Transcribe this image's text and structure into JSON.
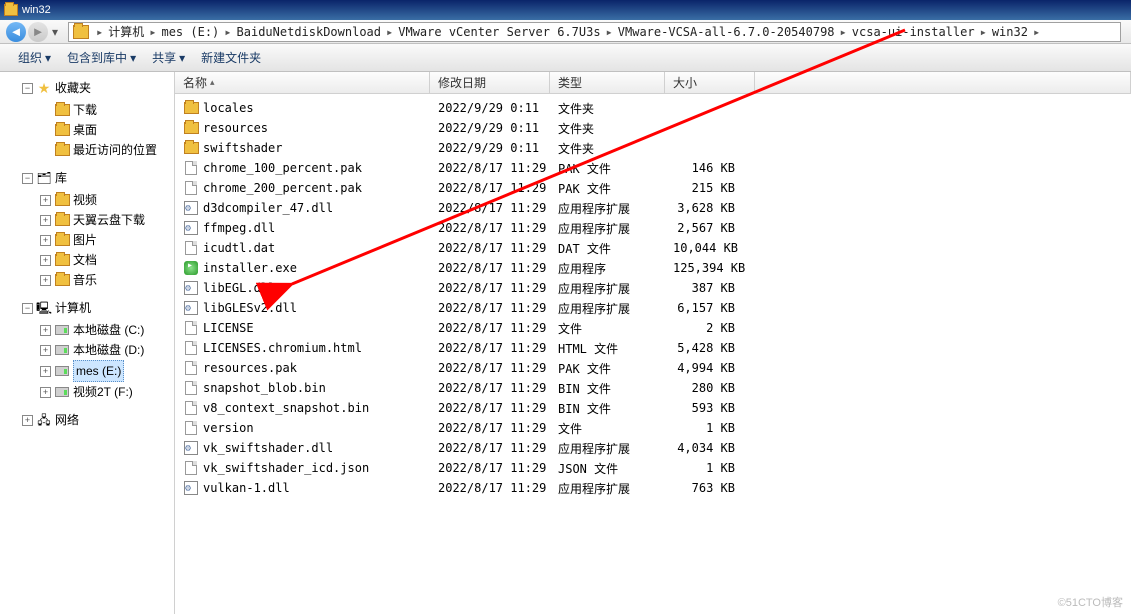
{
  "window": {
    "title": "win32"
  },
  "breadcrumbs": [
    "计算机",
    "mes (E:)",
    "BaiduNetdiskDownload",
    "VMware vCenter Server 6.7U3s",
    "VMware-VCSA-all-6.7.0-20540798",
    "vcsa-ui-installer",
    "win32"
  ],
  "toolbar": {
    "organize": "组织",
    "include": "包含到库中",
    "share": "共享",
    "newfolder": "新建文件夹"
  },
  "columns": {
    "name": "名称",
    "date": "修改日期",
    "type": "类型",
    "size": "大小"
  },
  "sidebar": {
    "favorites": {
      "label": "收藏夹",
      "items": [
        "下载",
        "桌面",
        "最近访问的位置"
      ]
    },
    "libraries": {
      "label": "库",
      "items": [
        "视频",
        "天翼云盘下载",
        "图片",
        "文档",
        "音乐"
      ]
    },
    "computer": {
      "label": "计算机",
      "items": [
        "本地磁盘 (C:)",
        "本地磁盘 (D:)",
        "mes (E:)",
        "视频2T (F:)"
      ]
    },
    "network": {
      "label": "网络"
    }
  },
  "files": [
    {
      "name": "locales",
      "date": "2022/9/29 0:11",
      "type": "文件夹",
      "size": "",
      "icon": "folder"
    },
    {
      "name": "resources",
      "date": "2022/9/29 0:11",
      "type": "文件夹",
      "size": "",
      "icon": "folder"
    },
    {
      "name": "swiftshader",
      "date": "2022/9/29 0:11",
      "type": "文件夹",
      "size": "",
      "icon": "folder"
    },
    {
      "name": "chrome_100_percent.pak",
      "date": "2022/8/17 11:29",
      "type": "PAK 文件",
      "size": "146 KB",
      "icon": "file"
    },
    {
      "name": "chrome_200_percent.pak",
      "date": "2022/8/17 11:29",
      "type": "PAK 文件",
      "size": "215 KB",
      "icon": "file"
    },
    {
      "name": "d3dcompiler_47.dll",
      "date": "2022/8/17 11:29",
      "type": "应用程序扩展",
      "size": "3,628 KB",
      "icon": "dll"
    },
    {
      "name": "ffmpeg.dll",
      "date": "2022/8/17 11:29",
      "type": "应用程序扩展",
      "size": "2,567 KB",
      "icon": "dll"
    },
    {
      "name": "icudtl.dat",
      "date": "2022/8/17 11:29",
      "type": "DAT 文件",
      "size": "10,044 KB",
      "icon": "file"
    },
    {
      "name": "installer.exe",
      "date": "2022/8/17 11:29",
      "type": "应用程序",
      "size": "125,394 KB",
      "icon": "exe"
    },
    {
      "name": "libEGL.dll",
      "date": "2022/8/17 11:29",
      "type": "应用程序扩展",
      "size": "387 KB",
      "icon": "dll"
    },
    {
      "name": "libGLESv2.dll",
      "date": "2022/8/17 11:29",
      "type": "应用程序扩展",
      "size": "6,157 KB",
      "icon": "dll"
    },
    {
      "name": "LICENSE",
      "date": "2022/8/17 11:29",
      "type": "文件",
      "size": "2 KB",
      "icon": "file"
    },
    {
      "name": "LICENSES.chromium.html",
      "date": "2022/8/17 11:29",
      "type": "HTML 文件",
      "size": "5,428 KB",
      "icon": "file"
    },
    {
      "name": "resources.pak",
      "date": "2022/8/17 11:29",
      "type": "PAK 文件",
      "size": "4,994 KB",
      "icon": "file"
    },
    {
      "name": "snapshot_blob.bin",
      "date": "2022/8/17 11:29",
      "type": "BIN 文件",
      "size": "280 KB",
      "icon": "file"
    },
    {
      "name": "v8_context_snapshot.bin",
      "date": "2022/8/17 11:29",
      "type": "BIN 文件",
      "size": "593 KB",
      "icon": "file"
    },
    {
      "name": "version",
      "date": "2022/8/17 11:29",
      "type": "文件",
      "size": "1 KB",
      "icon": "file"
    },
    {
      "name": "vk_swiftshader.dll",
      "date": "2022/8/17 11:29",
      "type": "应用程序扩展",
      "size": "4,034 KB",
      "icon": "dll"
    },
    {
      "name": "vk_swiftshader_icd.json",
      "date": "2022/8/17 11:29",
      "type": "JSON 文件",
      "size": "1 KB",
      "icon": "file"
    },
    {
      "name": "vulkan-1.dll",
      "date": "2022/8/17 11:29",
      "type": "应用程序扩展",
      "size": "763 KB",
      "icon": "dll"
    }
  ],
  "watermark": "©51CTO博客"
}
